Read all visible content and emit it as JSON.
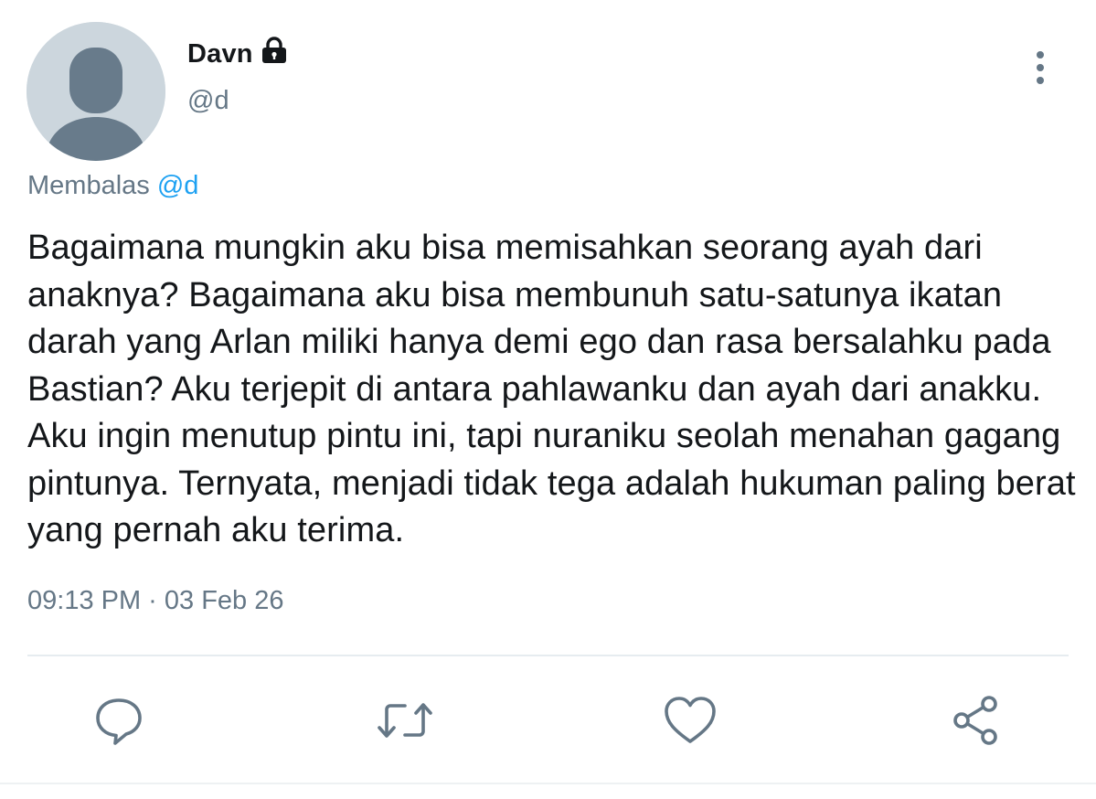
{
  "user": {
    "display_name": "Davn",
    "handle": "@d",
    "protected_icon": "lock-icon",
    "avatar_icon": "default-avatar-icon"
  },
  "reply_context": {
    "prefix": "Membalas",
    "mention": "@d"
  },
  "tweet": {
    "text": "Bagaimana mungkin aku bisa memisahkan seorang ayah dari anaknya? Bagaimana aku bisa membunuh satu-satunya ikatan darah yang Arlan miliki hanya demi ego dan rasa bersalahku pada Bastian? Aku terjepit di antara pahlawanku dan ayah dari anakku. Aku ingin menutup pintu ini, tapi nuraniku seolah menahan gagang pintunya. Ternyata, menjadi tidak tega adalah hukuman paling berat yang pernah aku terima.",
    "timestamp": "09:13 PM · 03 Feb 26"
  },
  "actions": [
    {
      "name": "reply",
      "icon": "comment-icon"
    },
    {
      "name": "retweet",
      "icon": "retweet-icon"
    },
    {
      "name": "like",
      "icon": "heart-icon"
    },
    {
      "name": "share",
      "icon": "share-icon"
    }
  ],
  "colors": {
    "text": "#14171a",
    "secondary": "#657786",
    "accent": "#1da1f2",
    "avatar_bg": "#ccd6dd",
    "avatar_fg": "#687b8b"
  }
}
